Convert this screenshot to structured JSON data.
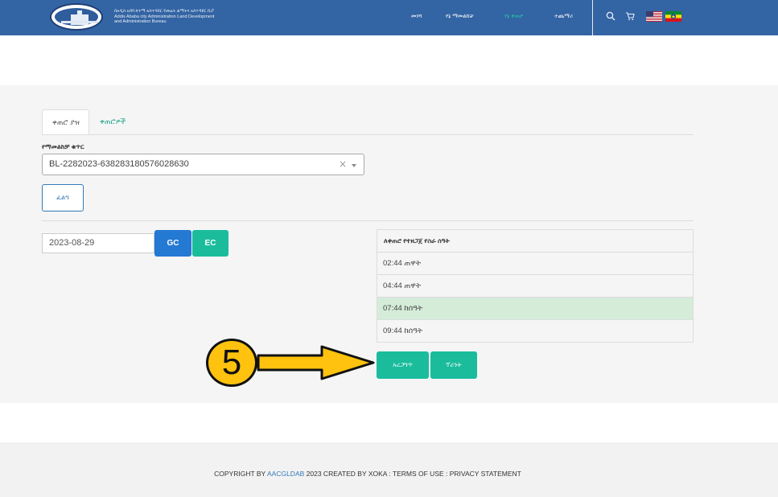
{
  "header": {
    "brand_lines": [
      "በአዲስ አበባ ከተማ አስተዳደር የመሬት ልማትና አስተዳደር ቢሮ",
      "Addis Ababa city Administration Land Development",
      "and Administration Bureau"
    ],
    "nav": [
      {
        "label": "መነሻ",
        "active": false
      },
      {
        "label": "የኔ ማመልከቻ",
        "active": false
      },
      {
        "label": "የኔ ቀጠሮ",
        "active": true
      },
      {
        "label": "ተጨማሪ",
        "active": false
      }
    ],
    "accent_color": "#1fcfa8",
    "header_color": "#3364a3"
  },
  "tabs": {
    "book": "ቀጠሮ ያዝ",
    "appointments": "ቀጠሮዎች"
  },
  "form": {
    "application_label": "የማመልከቻ ቁጥር",
    "application_value": "BL-2282023-638283180576028630",
    "clear_symbol": "×",
    "search_button": "ፈልግ",
    "date_value": "2023-08-29",
    "gc_label": "GC",
    "ec_label": "EC"
  },
  "slots": {
    "header": "ለቀጠሮ የተዘጋጀ የስራ ሰዓት",
    "items": [
      {
        "time": "02:44 ጠዋት",
        "selected": false
      },
      {
        "time": "04:44 ጠዋት",
        "selected": false
      },
      {
        "time": "07:44 ከሰዓት",
        "selected": true
      },
      {
        "time": "09:44 ከሰዓት",
        "selected": false
      }
    ]
  },
  "actions": {
    "confirm": "አረጋግጥ",
    "print": "ፕሪንት"
  },
  "callout": {
    "number": "5"
  },
  "footer": {
    "prefix": "COPYRIGHT BY",
    "link": "AACGLDAB",
    "suffix": "2023 CREATED BY XOKA : TERMS OF USE : PRIVACY STATEMENT"
  }
}
